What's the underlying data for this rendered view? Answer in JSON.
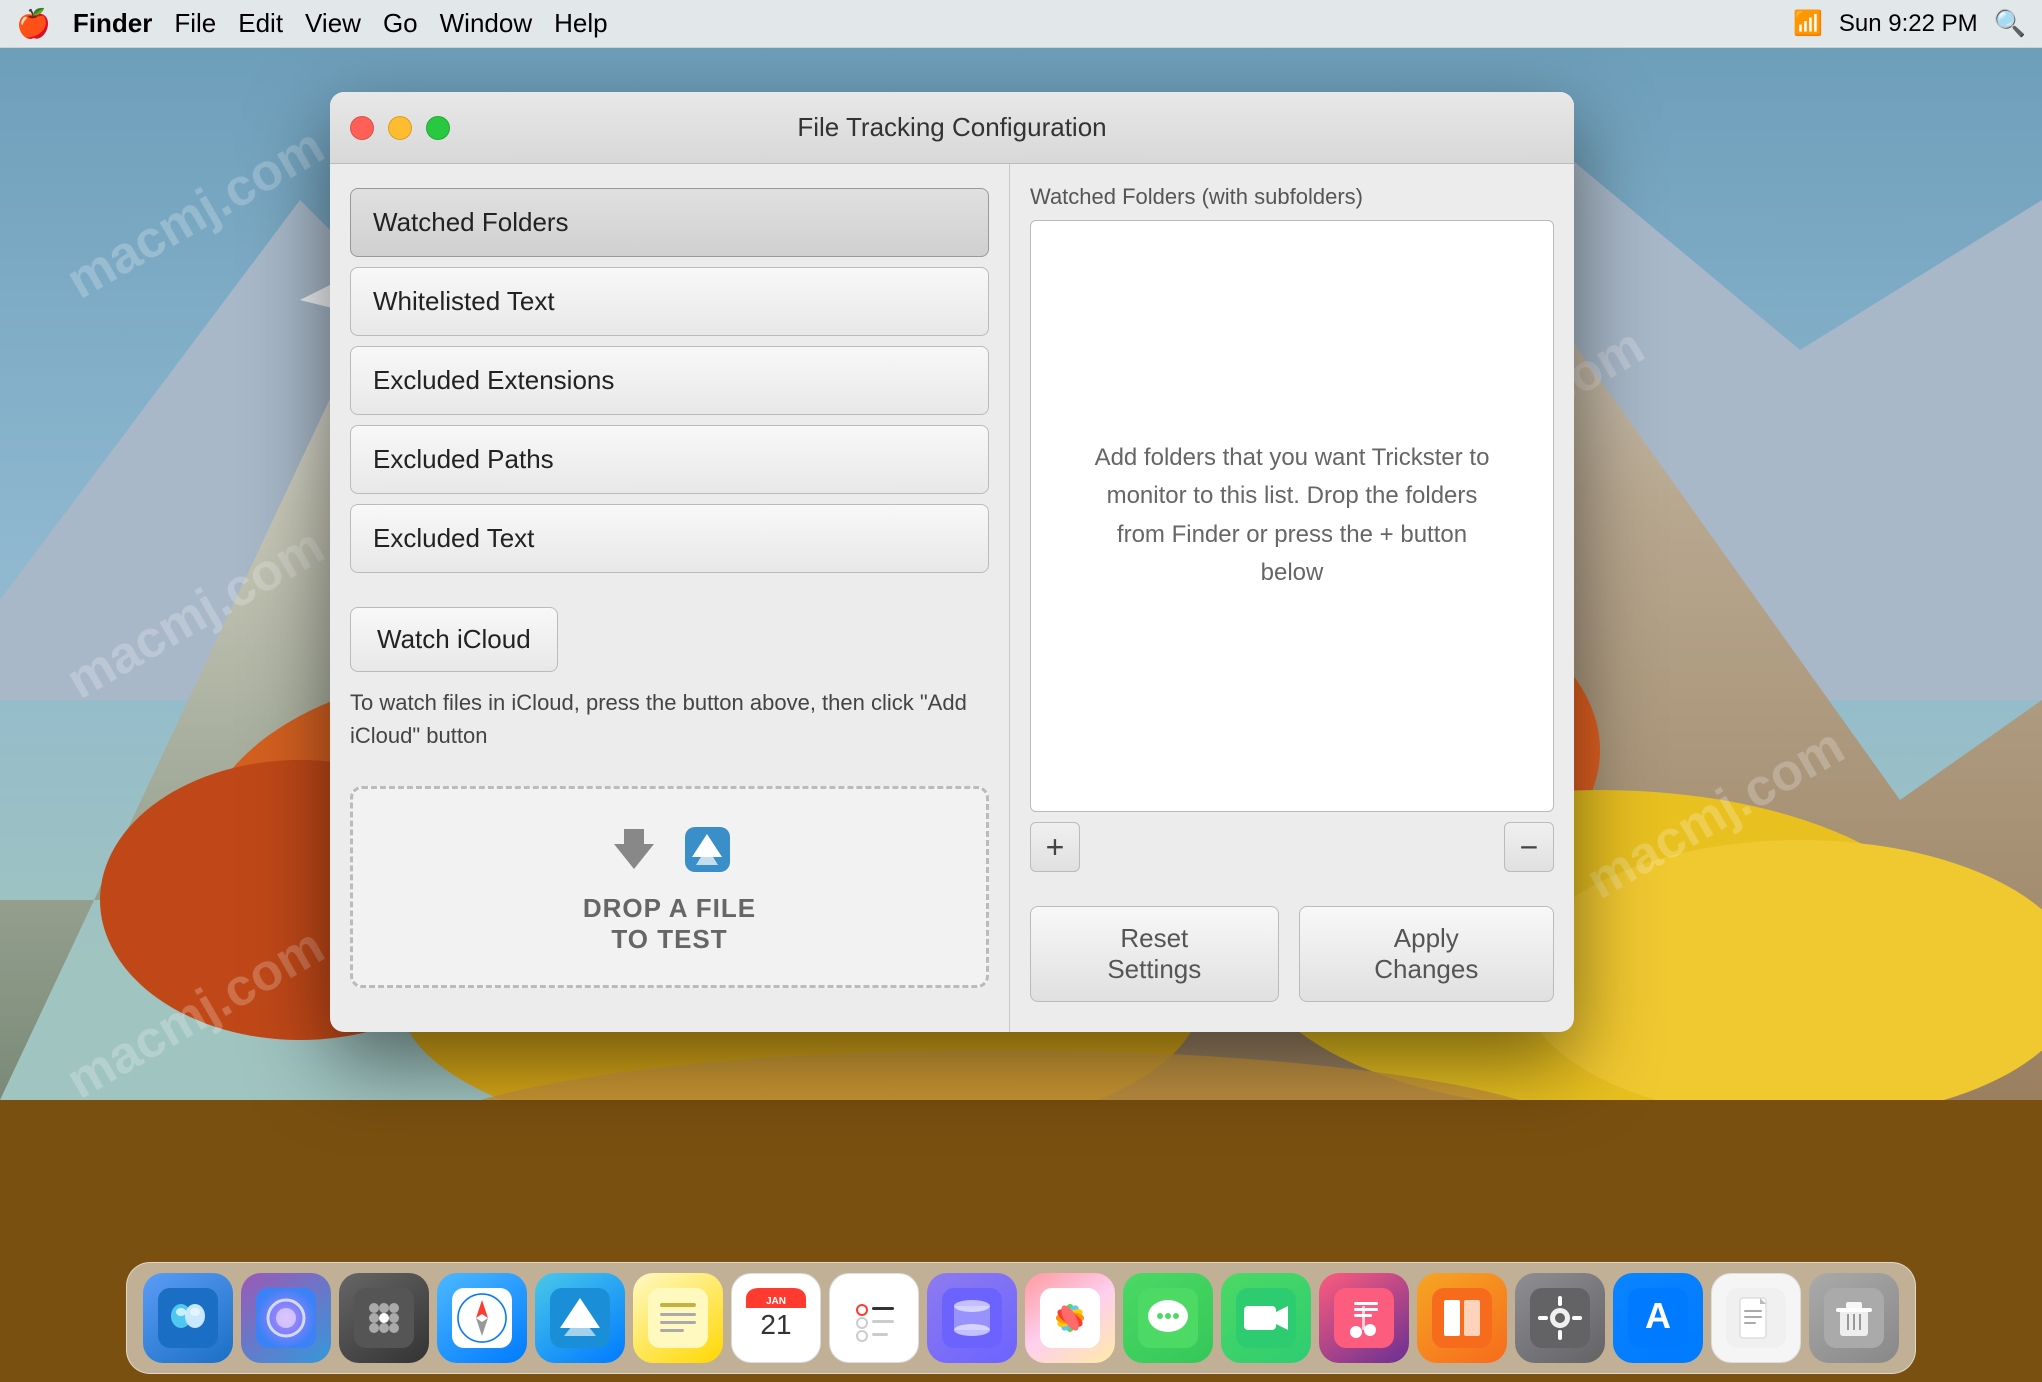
{
  "menubar": {
    "apple": "⌘",
    "app_name": "Finder",
    "menus": [
      "File",
      "Edit",
      "View",
      "Go",
      "Window",
      "Help"
    ],
    "time": "Sun 9:22 PM",
    "right_icons": [
      "🔧",
      "📶",
      "🔋",
      "⌚",
      "🖥"
    ]
  },
  "window": {
    "title": "File Tracking Configuration",
    "sidebar_items": [
      {
        "id": "watched-folders",
        "label": "Watched Folders",
        "active": true
      },
      {
        "id": "whitelisted-text",
        "label": "Whitelisted Text",
        "active": false
      },
      {
        "id": "excluded-extensions",
        "label": "Excluded Extensions",
        "active": false
      },
      {
        "id": "excluded-paths",
        "label": "Excluded Paths",
        "active": false
      },
      {
        "id": "excluded-text",
        "label": "Excluded Text",
        "active": false
      }
    ],
    "icloud_btn": "Watch iCloud",
    "icloud_desc": "To watch files in iCloud, press the button above, then click \"Add iCloud\" button",
    "drop_zone_text": "DROP A FILE\nTO TEST",
    "folder_list_header": "Watched Folders (with subfolders)",
    "folder_instructions": "Add folders that you want Trickster to monitor to this list. Drop the folders from Finder or press the + button below",
    "add_btn": "+",
    "remove_btn": "−",
    "reset_btn": "Reset Settings",
    "apply_btn": "Apply Changes"
  },
  "dock": {
    "icons": [
      {
        "name": "finder",
        "emoji": "🔵",
        "label": "Finder"
      },
      {
        "name": "siri",
        "emoji": "🎤",
        "label": "Siri"
      },
      {
        "name": "launchpad",
        "emoji": "🚀",
        "label": "Launchpad"
      },
      {
        "name": "safari",
        "emoji": "🧭",
        "label": "Safari"
      },
      {
        "name": "trickster",
        "emoji": "📦",
        "label": "Trickster"
      },
      {
        "name": "notes",
        "emoji": "📝",
        "label": "Notes"
      },
      {
        "name": "calendar",
        "emoji": "📅",
        "label": "Calendar"
      },
      {
        "name": "reminders",
        "emoji": "☑️",
        "label": "Reminders"
      },
      {
        "name": "canister",
        "emoji": "🗂",
        "label": "Canister"
      },
      {
        "name": "photos",
        "emoji": "🌸",
        "label": "Photos"
      },
      {
        "name": "messages",
        "emoji": "💬",
        "label": "Messages"
      },
      {
        "name": "facetime",
        "emoji": "📱",
        "label": "FaceTime"
      },
      {
        "name": "music",
        "emoji": "🎵",
        "label": "Music"
      },
      {
        "name": "books",
        "emoji": "📚",
        "label": "Books"
      },
      {
        "name": "prefs",
        "emoji": "⚙️",
        "label": "System Preferences"
      },
      {
        "name": "appstore",
        "emoji": "🅰️",
        "label": "App Store"
      },
      {
        "name": "file",
        "emoji": "📄",
        "label": "File"
      },
      {
        "name": "trash",
        "emoji": "🗑",
        "label": "Trash"
      }
    ]
  }
}
